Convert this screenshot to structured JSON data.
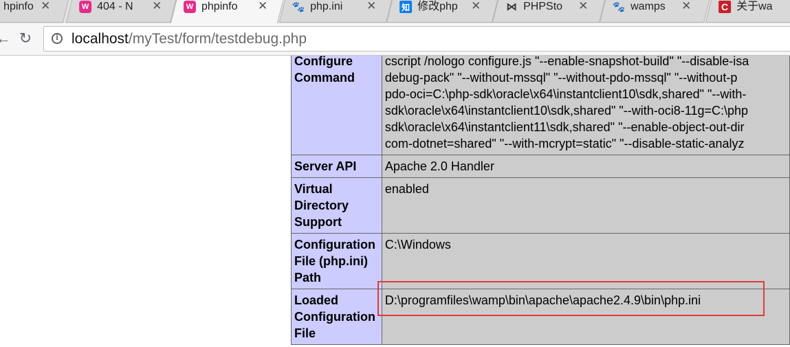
{
  "browser": {
    "tabs": [
      {
        "title": "hpinfo",
        "icon": "wampserver-icon",
        "active": false
      },
      {
        "title": "404 - N",
        "icon": "wampserver-icon",
        "active": false
      },
      {
        "title": "phpinfo",
        "icon": "wampserver-icon",
        "active": true
      },
      {
        "title": "php.ini",
        "icon": "baidu-paw-icon",
        "active": false
      },
      {
        "title": "修改php",
        "icon": "zhihu-icon",
        "active": false
      },
      {
        "title": "PHPSto",
        "icon": "phpstorm-icon",
        "active": false
      },
      {
        "title": "wamps",
        "icon": "baidu-paw-icon",
        "active": false
      },
      {
        "title": "关于wa",
        "icon": "csdn-icon",
        "active": false
      }
    ],
    "url": {
      "host": "localhost",
      "path": "/myTest/form/testdebug.php"
    }
  },
  "phpinfo": {
    "rows": [
      {
        "label": "Configure Command",
        "lines": [
          "cscript /nologo configure.js  \"--enable-snapshot-build\"  \"--disable-isa",
          "debug-pack\" \"--without-mssql\" \"--without-pdo-mssql\" \"--without-p",
          "pdo-oci=C:\\php-sdk\\oracle\\x64\\instantclient10\\sdk,shared\" \"--with-",
          "sdk\\oracle\\x64\\instantclient10\\sdk,shared\" \"--with-oci8-11g=C:\\php",
          "sdk\\oracle\\x64\\instantclient11\\sdk,shared\" \"--enable-object-out-dir",
          "com-dotnet=shared\" \"--with-mcrypt=static\" \"--disable-static-analyz"
        ]
      },
      {
        "label": "Server API",
        "lines": [
          "Apache 2.0 Handler"
        ]
      },
      {
        "label": "Virtual Directory Support",
        "lines": [
          "enabled"
        ]
      },
      {
        "label": "Configuration File (php.ini) Path",
        "lines": [
          "C:\\Windows"
        ]
      },
      {
        "label": "Loaded Configuration File",
        "lines": [
          "D:\\programfiles\\wamp\\bin\\apache\\apache2.4.9\\bin\\php.ini"
        ]
      }
    ]
  },
  "colors": {
    "label_bg": "#ccccff",
    "value_bg": "#cccccc",
    "highlight": "#e03a3a"
  }
}
